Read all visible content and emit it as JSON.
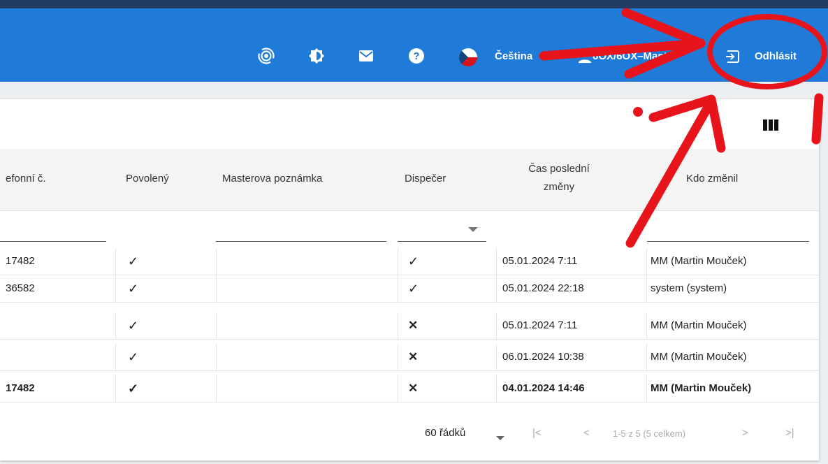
{
  "header": {
    "language_label": "Čeština",
    "user_label": "6OX/6OX–Master",
    "logout_label": "Odhlásit",
    "accent_color": "#1f7ad8"
  },
  "icons": [
    "broadcast-icon",
    "brightness-icon",
    "mail-icon",
    "help-icon",
    "czech-flag-icon",
    "user-icon",
    "logout-icon",
    "columns-icon"
  ],
  "table": {
    "columns": [
      "efonní č.",
      "Povolený",
      "Masterova poznámka",
      "Dispečer",
      "Čas poslední změny",
      "Kdo změnil"
    ],
    "rows": [
      {
        "phone": "17482",
        "enabled": "✓",
        "note": "",
        "dispatcher": "✓",
        "changed": "05.01.2024 7:11",
        "who": "MM (Martin Mouček)"
      },
      {
        "phone": "36582",
        "enabled": "✓",
        "note": "",
        "dispatcher": "✓",
        "changed": "05.01.2024 22:18",
        "who": "system (system)"
      },
      {
        "phone": "",
        "enabled": "✓",
        "note": "",
        "dispatcher": "✕",
        "changed": "05.01.2024 7:11",
        "who": "MM (Martin Mouček)"
      },
      {
        "phone": "",
        "enabled": "✓",
        "note": "",
        "dispatcher": "✕",
        "changed": "06.01.2024 10:38",
        "who": "MM (Martin Mouček)"
      },
      {
        "phone": "17482",
        "enabled": "✓",
        "note": "",
        "dispatcher": "✕",
        "changed": "04.01.2024 14:46",
        "who": "MM (Martin Mouček)"
      }
    ]
  },
  "pagination": {
    "rows_per_page": "60 řádků",
    "range": "1-5 z 5 (5 celkem)"
  },
  "annotation_color": "#e8141c"
}
